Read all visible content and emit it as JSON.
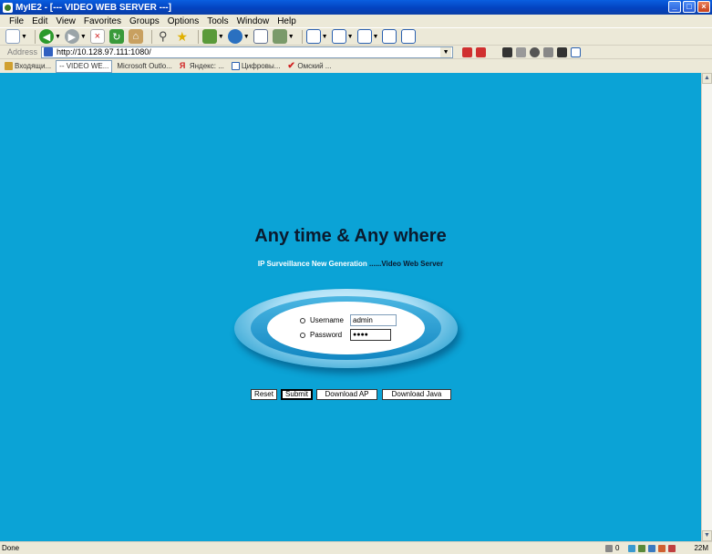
{
  "window": {
    "title": "MyIE2 - [--- VIDEO WEB SERVER ---]"
  },
  "menu": [
    "File",
    "Edit",
    "View",
    "Favorites",
    "Groups",
    "Options",
    "Tools",
    "Window",
    "Help"
  ],
  "toolbar_icons": [
    "new-page-icon",
    "back-icon",
    "forward-icon",
    "stop-icon",
    "refresh-icon",
    "home-icon",
    "search-icon",
    "favorites-icon",
    "groups-icon",
    "globe-icon",
    "channel-icon",
    "view-icon",
    "undo-icon",
    "layout-icon",
    "tile-icon",
    "close-tab-icon",
    "edit-icon"
  ],
  "address": {
    "label": "Address",
    "url": "http://10.128.97.111:1080/"
  },
  "tabs": [
    {
      "label": "Входящи...",
      "active": false
    },
    {
      "label": "-- VIDEO WE...",
      "active": true
    },
    {
      "label": "Microsoft Outlo...",
      "active": false
    },
    {
      "label": "Яндекс: ...",
      "active": false
    },
    {
      "label": "Цифровы...",
      "active": false
    },
    {
      "label": "Омский ...",
      "active": false
    }
  ],
  "page": {
    "headline": "Any time & Any where",
    "sub_part1": "IP Surveillance New Generation",
    "sub_part2": " ......Video Web Server",
    "username_label": "Username",
    "username_value": "admin",
    "password_label": "Password",
    "password_value": "●●●●",
    "buttons": {
      "reset": "Reset",
      "submit": "Submit",
      "download_ap": "Download AP",
      "download_java": "Download Java"
    },
    "background_color": "#0ba3d6"
  },
  "status": {
    "text": "Done",
    "count": "0",
    "memory": "22M"
  }
}
